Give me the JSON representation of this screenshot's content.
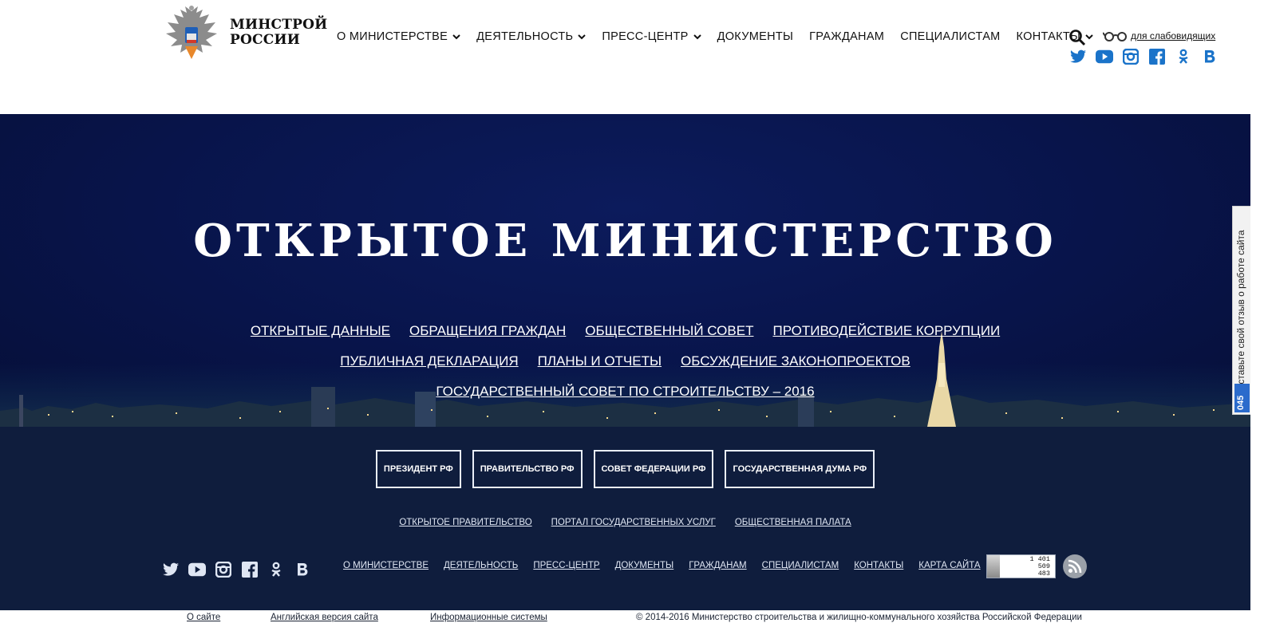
{
  "header": {
    "logo_line1": "МИНСТРОЙ",
    "logo_line2": "РОССИИ",
    "nav": [
      {
        "label": "О МИНИСТЕРСТВЕ",
        "dropdown": true
      },
      {
        "label": "ДЕЯТЕЛЬНОСТЬ",
        "dropdown": true
      },
      {
        "label": "ПРЕСС-ЦЕНТР",
        "dropdown": true
      },
      {
        "label": "ДОКУМЕНТЫ",
        "dropdown": false
      },
      {
        "label": "ГРАЖДАНАМ",
        "dropdown": false
      },
      {
        "label": "СПЕЦИАЛИСТАМ",
        "dropdown": false
      },
      {
        "label": "КОНТАКТЫ",
        "dropdown": true
      }
    ],
    "accessibility_label": "для слабовидящих",
    "social_icons": [
      "twitter-icon",
      "youtube-icon",
      "instagram-icon",
      "facebook-icon",
      "odnoklassniki-icon",
      "vk-icon"
    ],
    "accent_color": "#1a73c9"
  },
  "hero": {
    "title": "ОТКРЫТОЕ МИНИСТЕРСТВО",
    "row1": [
      "ОТКРЫТЫЕ ДАННЫЕ",
      "ОБРАЩЕНИЯ ГРАЖДАН",
      "ОБЩЕСТВЕННЫЙ СОВЕТ",
      "ПРОТИВОДЕЙСТВИЕ КОРРУПЦИИ"
    ],
    "row2": [
      "ПУБЛИЧНАЯ ДЕКЛАРАЦИЯ",
      "ПЛАНЫ И ОТЧЕТЫ",
      "ОБСУЖДЕНИЕ ЗАКОНОПРОЕКТОВ"
    ],
    "row3": [
      "ГОСУДАРСТВЕННЫЙ СОВЕТ ПО СТРОИТЕЛЬСТВУ – 2016"
    ],
    "background_color": "#08144a"
  },
  "feedback": {
    "text": "Оставьте свой отзыв о работе сайта",
    "badge": "045"
  },
  "footer": {
    "gov_buttons": [
      "ПРЕЗИДЕНТ РФ",
      "ПРАВИТЕЛЬСТВО РФ",
      "СОВЕТ ФЕДЕРАЦИИ РФ",
      "ГОСУДАРСТВЕННАЯ ДУМА РФ"
    ],
    "gov_links": [
      "ОТКРЫТОЕ ПРАВИТЕЛЬСТВО",
      "ПОРТАЛ ГОСУДАРСТВЕННЫХ УСЛУГ",
      "ОБЩЕСТВЕННАЯ ПАЛАТА"
    ],
    "nav": [
      "О МИНИСТЕРСТВЕ",
      "ДЕЯТЕЛЬНОСТЬ",
      "ПРЕСС-ЦЕНТР",
      "ДОКУМЕНТЫ",
      "ГРАЖДАНАМ",
      "СПЕЦИАЛИСТАМ",
      "КОНТАКТЫ",
      "КАРТА САЙТА"
    ],
    "counter": [
      "1 401",
      "509",
      "483"
    ],
    "background_color": "#0f1d3d"
  },
  "bottom": {
    "about": "О сайте",
    "english": "Английская версия сайта",
    "info_systems": "Информационные системы",
    "copyright": "© 2014-2016 Министерство строительства и жилищно-коммунального хозяйства Российской Федерации"
  }
}
